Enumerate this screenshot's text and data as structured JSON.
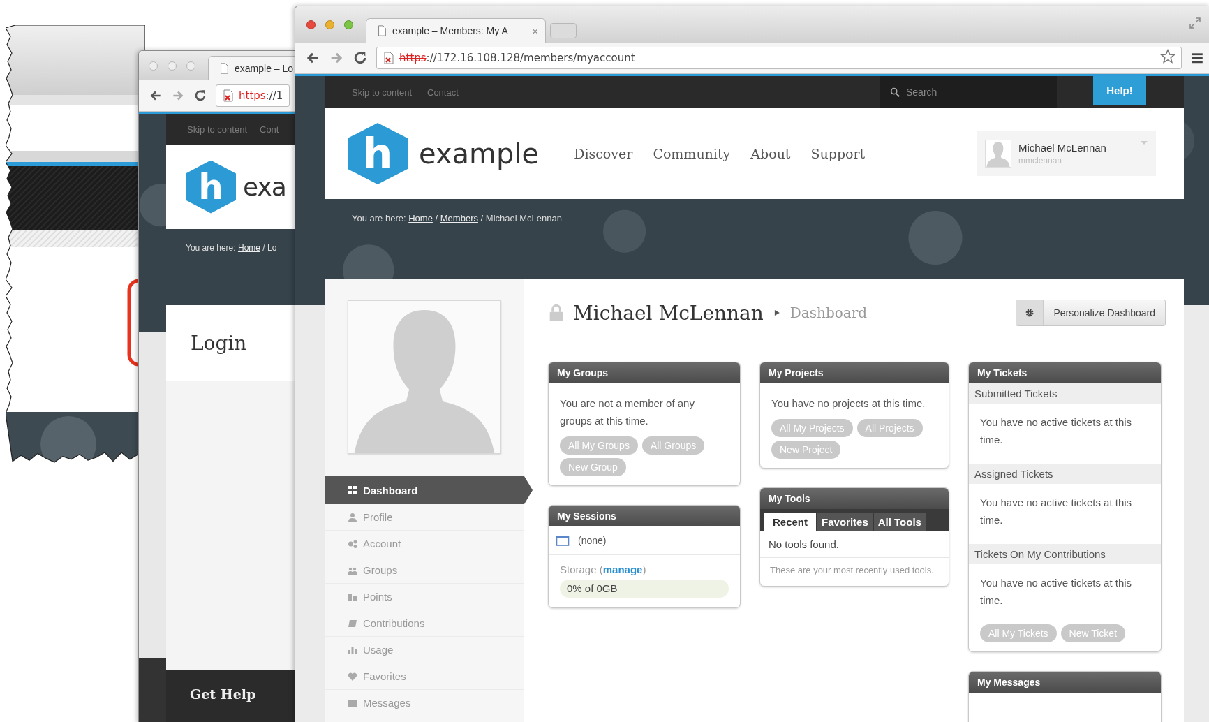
{
  "login_window": {
    "tab_title": "example – Lo",
    "url_scheme": "https",
    "url_rest": "://1",
    "top_links": [
      "Skip to content",
      "Cont"
    ],
    "logo_mark": "h",
    "logo_text": "exa",
    "breadcrumb": {
      "label": "You are here:",
      "links": [
        "Home"
      ],
      "separator": "/",
      "current": "Lo"
    },
    "page_title": "Login",
    "footer_link": "Get Help"
  },
  "main_window": {
    "tab_title": "example – Members: My A",
    "tab_close": "×",
    "url_scheme": "https",
    "url_rest": "://172.16.108.128/members/myaccount",
    "top_links": [
      "Skip to content",
      "Contact"
    ],
    "search": {
      "placeholder": "Search"
    },
    "help_button": "Help!",
    "logo_mark": "h",
    "logo_text": "example",
    "nav": [
      "Discover",
      "Community",
      "About",
      "Support"
    ],
    "user": {
      "name": "Michael McLennan",
      "username": "mmclennan"
    },
    "breadcrumb": {
      "label": "You are here:",
      "links": [
        "Home",
        "Members"
      ],
      "separator": "/",
      "current": "Michael McLennan"
    },
    "profile_name": "Michael McLennan",
    "section": "Dashboard",
    "personalize_button": "Personalize Dashboard",
    "menu": [
      {
        "label": "Dashboard",
        "selected": true
      },
      {
        "label": "Profile",
        "selected": false
      },
      {
        "label": "Account",
        "selected": false
      },
      {
        "label": "Groups",
        "selected": false
      },
      {
        "label": "Points",
        "selected": false
      },
      {
        "label": "Contributions",
        "selected": false
      },
      {
        "label": "Usage",
        "selected": false
      },
      {
        "label": "Favorites",
        "selected": false
      },
      {
        "label": "Messages",
        "selected": false
      }
    ],
    "columns": [
      [
        {
          "kind": "text",
          "title": "My Groups",
          "text": "You are not a member of any groups at this time.",
          "buttons": [
            "All My Groups",
            "All Groups",
            "New Group"
          ]
        },
        {
          "kind": "sessions",
          "title": "My Sessions",
          "session": "(none)",
          "storage": {
            "before": "Storage (",
            "link": "manage",
            "after": ")"
          },
          "meter": {
            "reading": "0% of 0GB",
            "level": 0
          }
        }
      ],
      [
        {
          "kind": "text",
          "title": "My Projects",
          "text": "You have no projects at this time.",
          "buttons": [
            "All My Projects",
            "All Projects",
            "New Project"
          ]
        },
        {
          "kind": "tools",
          "title": "My Tools",
          "tabs": [
            {
              "label": "Recent",
              "selected": true
            },
            {
              "label": "Favorites",
              "selected": false
            },
            {
              "label": "All Tools",
              "selected": false
            }
          ],
          "message": "No tools found.",
          "note": "These are your most recently used tools."
        }
      ],
      [
        {
          "kind": "tickets",
          "title": "My Tickets",
          "sections": [
            {
              "heading": "Submitted Tickets",
              "text": "You have no active tickets at this time."
            },
            {
              "heading": "Assigned Tickets",
              "text": "You have no active tickets at this time."
            },
            {
              "heading": "Tickets On My Contributions",
              "text": "You have no active tickets at this time."
            }
          ],
          "buttons": [
            "All My Tickets",
            "New Ticket"
          ]
        },
        {
          "kind": "header",
          "title": "My Messages"
        }
      ]
    ]
  }
}
